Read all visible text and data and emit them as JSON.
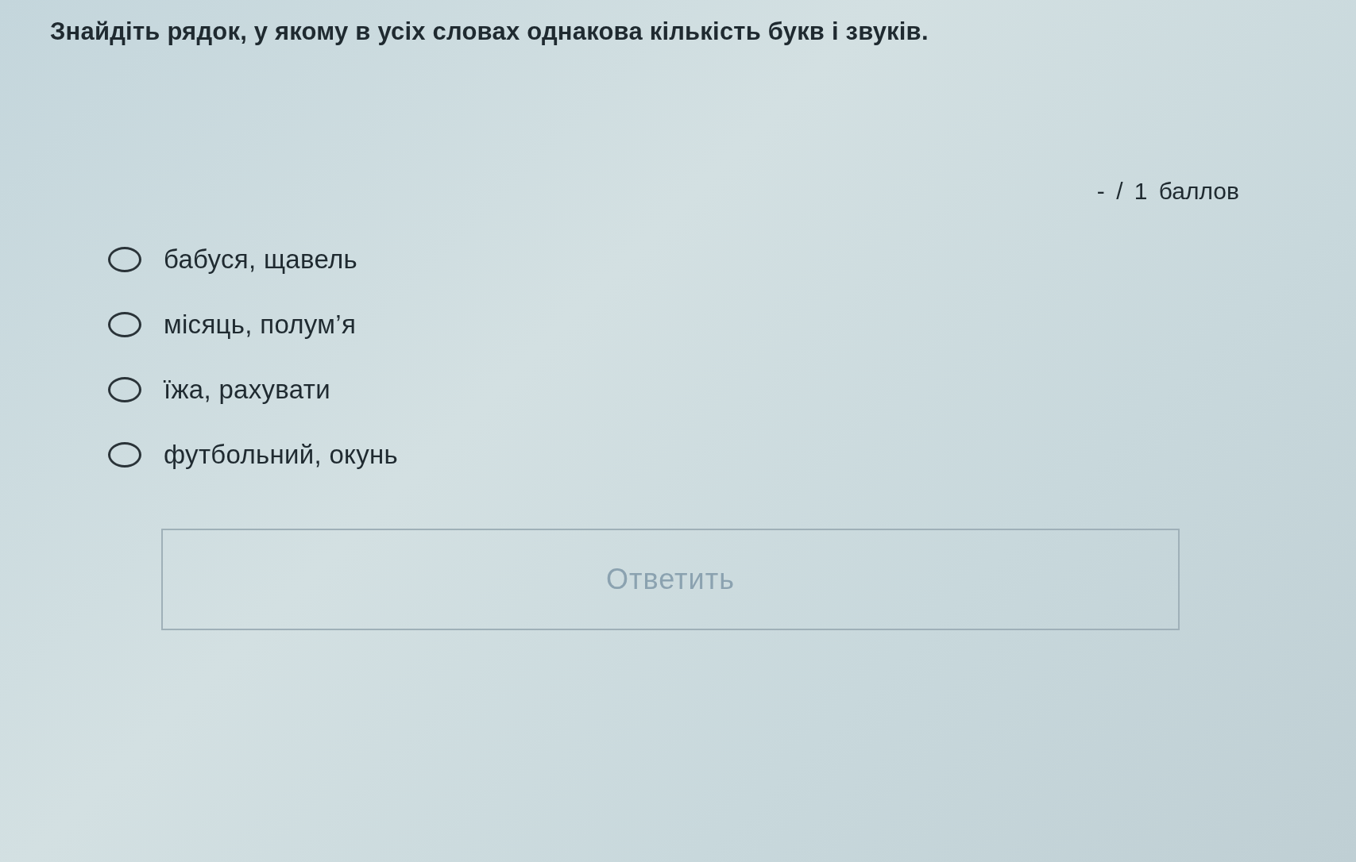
{
  "question": "Знайдіть рядок, у якому в усіх словах однакова кількість букв і звуків.",
  "points": "- / 1 баллов",
  "options": [
    {
      "label": "бабуся, щавель",
      "selected": false
    },
    {
      "label": "місяць, полум’я",
      "selected": false
    },
    {
      "label": "їжа, рахувати",
      "selected": false
    },
    {
      "label": "футбольний, окунь",
      "selected": false
    }
  ],
  "submit": {
    "label": "Ответить",
    "disabled": true
  }
}
